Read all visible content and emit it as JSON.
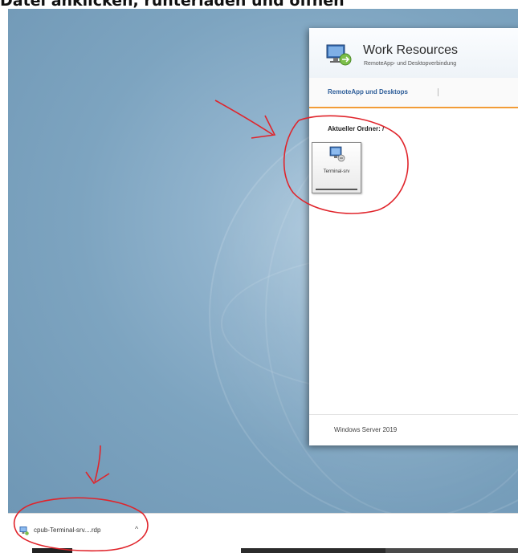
{
  "caption": "Datei anklicken, runterladen und öffnen",
  "window": {
    "title": "Work Resources",
    "subtitle": "RemoteApp- und Desktopverbindung",
    "nav_tab": "RemoteApp und Desktops",
    "folder_label": "Aktueller Ordner: /",
    "tile_label": "Terminal-srv",
    "footer": "Windows Server 2019"
  },
  "download": {
    "filename": "cpub-Terminal-srv....rdp",
    "chevron": "^"
  },
  "colors": {
    "accent_orange": "#f29c38",
    "nav_blue": "#2f5f9a",
    "annotation_red": "#e0242b",
    "desktop_blue": "#7da4c0"
  },
  "icons": {
    "app": "remote-desktop-icon",
    "tile": "remote-computer-icon",
    "download": "rdp-file-icon",
    "chevron": "chevron-up-icon"
  }
}
